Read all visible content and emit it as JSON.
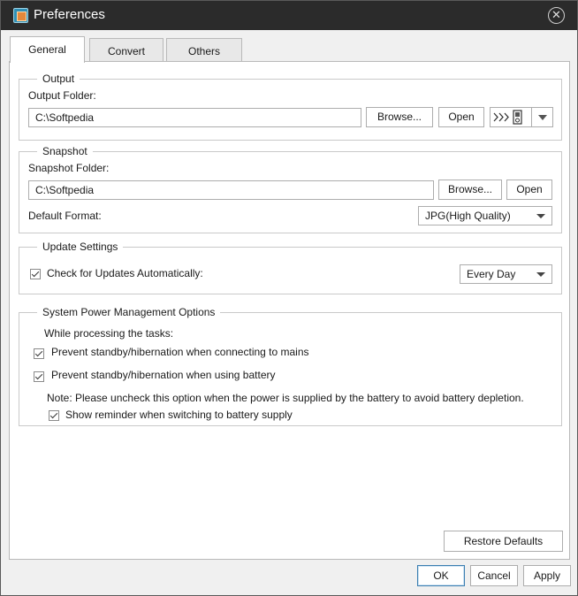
{
  "window": {
    "title": "Preferences"
  },
  "tabs": [
    {
      "label": "General",
      "active": true
    },
    {
      "label": "Convert",
      "active": false
    },
    {
      "label": "Others",
      "active": false
    }
  ],
  "output": {
    "legend": "Output",
    "folder_label": "Output Folder:",
    "folder_value": "C:\\Softpedia",
    "browse_label": "Browse...",
    "open_label": "Open",
    "device_icon": "device-player-icon"
  },
  "snapshot": {
    "legend": "Snapshot",
    "folder_label": "Snapshot Folder:",
    "folder_value": "C:\\Softpedia",
    "browse_label": "Browse...",
    "open_label": "Open",
    "format_label": "Default Format:",
    "format_value": "JPG(High Quality)"
  },
  "update": {
    "legend": "Update Settings",
    "check_label": "Check for Updates Automatically:",
    "check_checked": true,
    "frequency_value": "Every Day"
  },
  "power": {
    "legend": "System Power Management Options",
    "intro": "While processing the tasks:",
    "mains_label": "Prevent standby/hibernation when connecting to mains",
    "mains_checked": true,
    "battery_label": "Prevent standby/hibernation when using battery",
    "battery_checked": true,
    "note": "Note: Please uncheck this option when the power is supplied by the battery to avoid battery depletion.",
    "reminder_label": "Show reminder when switching to battery supply",
    "reminder_checked": true
  },
  "restore_defaults_label": "Restore Defaults",
  "footer": {
    "ok_label": "OK",
    "cancel_label": "Cancel",
    "apply_label": "Apply"
  }
}
